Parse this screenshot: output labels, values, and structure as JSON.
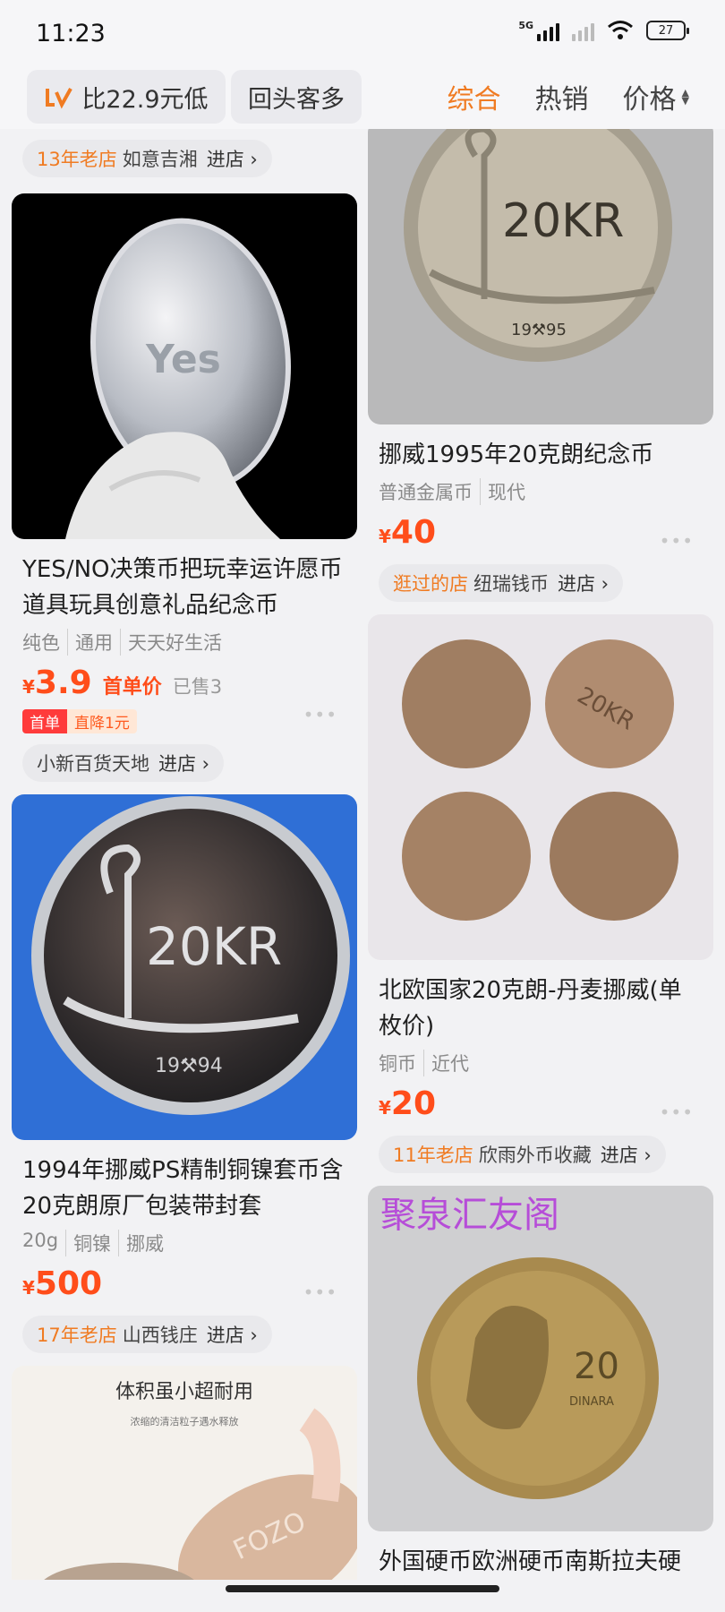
{
  "status": {
    "time": "11:23",
    "net_label": "5G",
    "battery": "27"
  },
  "filter": {
    "compare_logo": "比价",
    "compare_label": "比22.9元低",
    "repeat_label": "回头客多",
    "sorts": [
      {
        "label": "综合"
      },
      {
        "label": "热销"
      },
      {
        "label": "价格"
      }
    ]
  },
  "top_shop": {
    "age": "13年老店",
    "name": "如意吉湘",
    "enter": "进店 ›"
  },
  "left": [
    {
      "title": "YES/NO决策币把玩幸运许愿币道具玩具创意礼品纪念币",
      "tags": [
        "纯色",
        "通用",
        "天天好生活"
      ],
      "currency": "¥",
      "price": "3.9",
      "price_note": "首单价",
      "sold": "已售3",
      "promo_a": "首单",
      "promo_b": "直降1元",
      "shop": {
        "name": "小新百货天地",
        "enter": "进店 ›"
      },
      "image_text": "Yes"
    },
    {
      "title": "1994年挪威PS精制铜镍套币含20克朗原厂包装带封套",
      "tags": [
        "20g",
        "铜镍",
        "挪威"
      ],
      "currency": "¥",
      "price": "500",
      "shop": {
        "age": "17年老店",
        "name": "山西钱庄",
        "enter": "进店 ›"
      },
      "image_text": "20KR",
      "image_year": "19⚒94"
    },
    {
      "image_title": "体积虽小超耐用",
      "image_subtitle": "浓缩的清洁粒子遇水释放",
      "image_text": "FOZO"
    }
  ],
  "right": [
    {
      "title": "挪威1995年20克朗纪念币",
      "tags": [
        "普通金属币",
        "现代"
      ],
      "currency": "¥",
      "price": "40",
      "shop": {
        "age": "逛过的店",
        "name": "纽瑞钱币",
        "enter": "进店 ›"
      },
      "image_text": "20KR",
      "image_year": "19⚒95"
    },
    {
      "title": "北欧国家20克朗-丹麦挪威(单枚价)",
      "tags": [
        "铜币",
        "近代"
      ],
      "currency": "¥",
      "price": "20",
      "shop": {
        "age": "11年老店",
        "name": "欣雨外币收藏",
        "enter": "进店 ›"
      },
      "image_text": "20KR"
    },
    {
      "watermark": "聚泉汇友阁",
      "image_text": "20",
      "image_sub": "DINARA",
      "title": "外国硬币欧洲硬币南斯拉夫硬"
    }
  ],
  "colors": {
    "accent": "#f07b22",
    "price": "#ff4d1a"
  }
}
